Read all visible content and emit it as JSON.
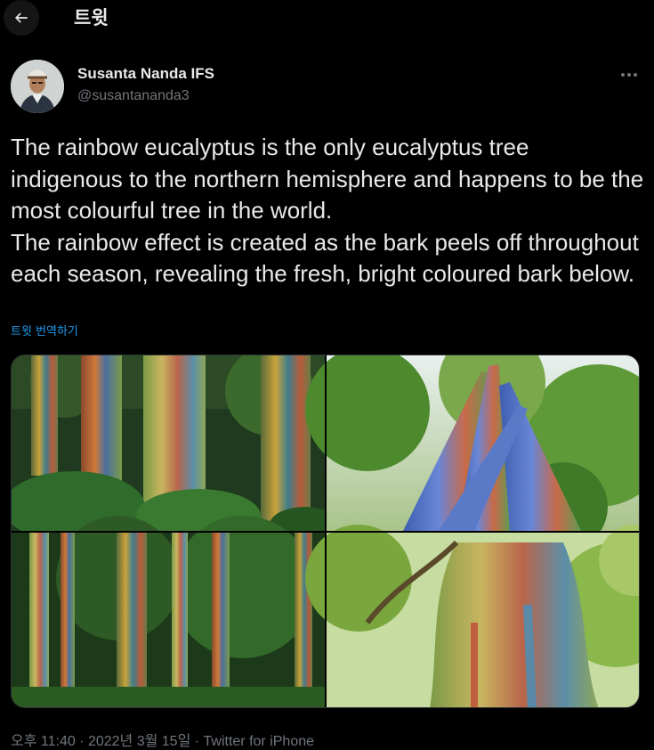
{
  "header": {
    "title": "트윗",
    "back_icon": "arrow-left-icon"
  },
  "author": {
    "display_name": "Susanta Nanda IFS",
    "handle": "@susantananda3"
  },
  "tweet": {
    "text": "The rainbow eucalyptus is the only eucalyptus tree indigenous to the northern hemisphere and happens to be the most colourful tree in the world.\nThe rainbow effect is created as the bark peels off throughout each season, revealing the fresh, bright coloured bark below.",
    "translate_label": "트윗 번역하기",
    "timestamp": "오후 11:40 · 2022년 3월 15일 · Twitter for iPhone"
  },
  "colors": {
    "background": "#000000",
    "text": "#e7e9ea",
    "secondary": "#71767b",
    "accent": "#1d9bf0"
  }
}
